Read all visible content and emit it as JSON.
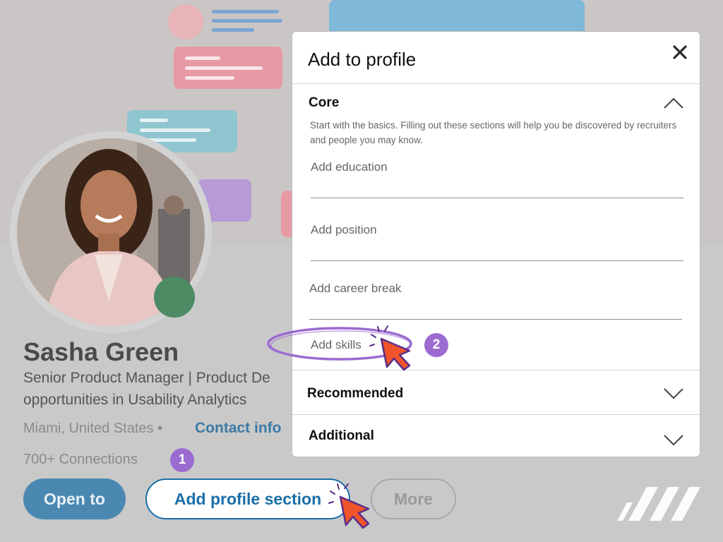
{
  "profile": {
    "name": "Sasha Green",
    "headline_line1": "Senior Product Manager | Product De",
    "headline_line2": "opportunities in Usability Analytics",
    "location": "Miami, United States •",
    "contact_info_label": "Contact info",
    "connections": "700+ Connections"
  },
  "actions": {
    "open_to_label": "Open to",
    "add_profile_section_label": "Add profile section",
    "more_label": "More"
  },
  "steps": {
    "step1": "1",
    "step2": "2"
  },
  "modal": {
    "title": "Add to profile",
    "core": {
      "title": "Core",
      "description": "Start with the basics. Filling out these sections will help you be discovered by recruiters and people you may know.",
      "options": [
        {
          "label": "Add education"
        },
        {
          "label": "Add position"
        },
        {
          "label": "Add career break"
        },
        {
          "label": "Add skills"
        }
      ]
    },
    "recommended": {
      "title": "Recommended"
    },
    "additional": {
      "title": "Additional"
    }
  },
  "icons": {
    "close": "close-icon",
    "chevron_up": "chevron-up-icon",
    "chevron_down": "chevron-down-icon",
    "cursor": "cursor-arrow-icon"
  },
  "colors": {
    "primary_blue": "#1a6ea8",
    "step_purple": "#9b6bd1",
    "cursor_orange": "#f0542a",
    "status_green": "#4c8b63",
    "highlight_ring": "#9b6bd1"
  }
}
